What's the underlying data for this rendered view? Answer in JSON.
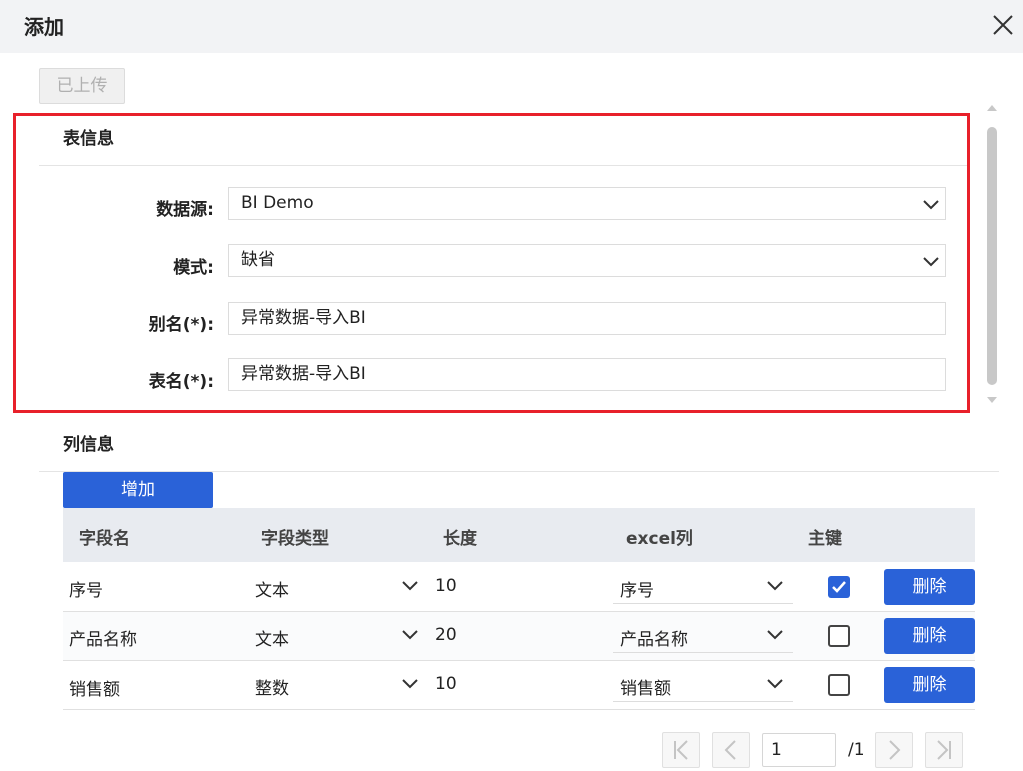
{
  "dialog": {
    "title": "添加"
  },
  "toolbar": {
    "uploaded_label": "已上传"
  },
  "table_info": {
    "section_title": "表信息",
    "datasource_label": "数据源:",
    "datasource_value": "BI Demo",
    "mode_label": "模式:",
    "mode_value": "缺省",
    "alias_label": "别名(*):",
    "alias_value": "异常数据-导入BI",
    "table_name_label": "表名(*):",
    "table_name_value": "异常数据-导入BI"
  },
  "column_info": {
    "section_title": "列信息",
    "add_label": "增加",
    "headers": [
      "字段名",
      "字段类型",
      "长度",
      "excel列",
      "主键"
    ],
    "rows": [
      {
        "field": "序号",
        "type": "文本",
        "length": "10",
        "excel": "序号",
        "primary": true,
        "delete_label": "删除"
      },
      {
        "field": "产品名称",
        "type": "文本",
        "length": "20",
        "excel": "产品名称",
        "primary": false,
        "delete_label": "删除"
      },
      {
        "field": "销售额",
        "type": "整数",
        "length": "10",
        "excel": "销售额",
        "primary": false,
        "delete_label": "删除"
      }
    ]
  },
  "pagination": {
    "current_page": "1",
    "total_label": "/1"
  },
  "colors": {
    "accent": "#2a62d8",
    "highlight_border": "#e8202a",
    "header_bg": "#f2f3f5",
    "grid_header_bg": "#e8ebf0"
  }
}
